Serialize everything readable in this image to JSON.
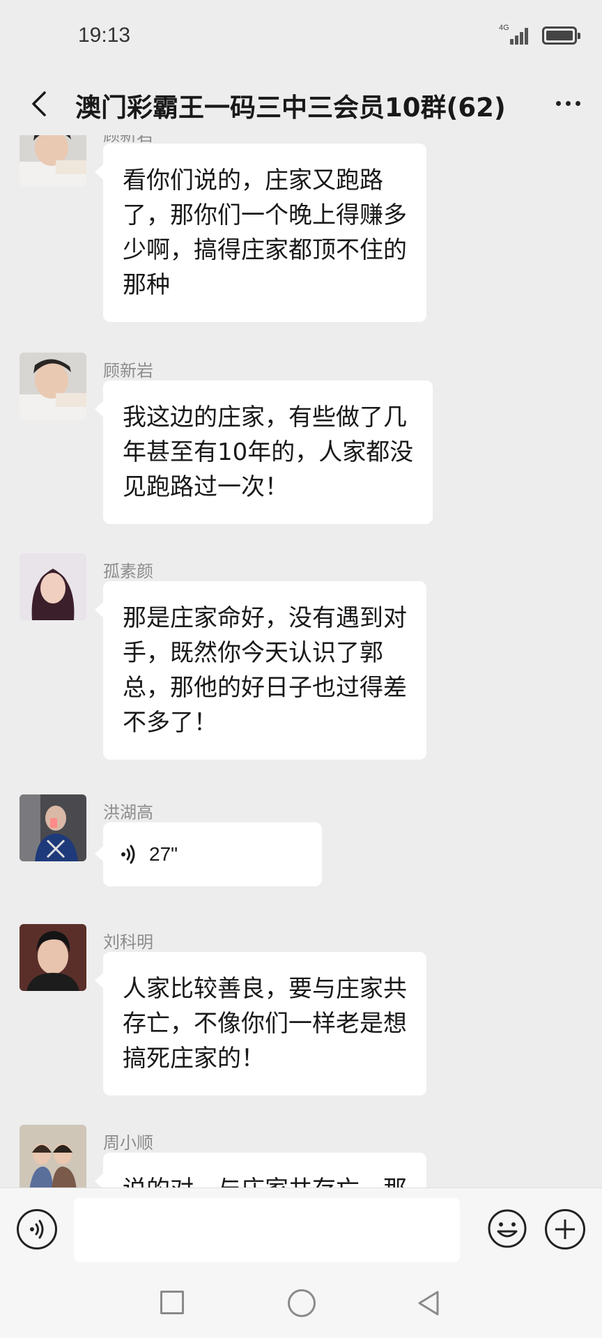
{
  "status_bar": {
    "time": "19:13",
    "network": "4G"
  },
  "header": {
    "title": "澳门彩霸王一码三中三会员10群(62)",
    "back_icon": "chevron-left-icon",
    "more_icon": "more-dots-icon"
  },
  "messages": [
    {
      "sender": "顾新岩",
      "type": "text",
      "lines": [
        "看你们说的，庄家又跑路",
        "了，那你们一个晚上得赚多",
        "少啊，搞得庄家都顶不住的",
        "那种"
      ]
    },
    {
      "sender": "顾新岩",
      "type": "text",
      "lines": [
        "我这边的庄家，有些做了几",
        "年甚至有10年的，人家都没",
        "见跑路过一次！"
      ]
    },
    {
      "sender": "孤素颜",
      "type": "text",
      "lines": [
        "那是庄家命好，没有遇到对",
        "手，既然你今天认识了郭",
        "总，那他的好日子也过得差",
        "不多了！"
      ]
    },
    {
      "sender": "洪湖高",
      "type": "voice",
      "duration": "27\""
    },
    {
      "sender": "刘科明",
      "type": "text",
      "lines": [
        "人家比较善良，要与庄家共",
        "存亡，不像你们一样老是想",
        "搞死庄家的！"
      ]
    },
    {
      "sender": "周小顺",
      "type": "text",
      "lines": [
        "说的对，与庄家共存亡，那"
      ]
    }
  ],
  "input_bar": {
    "voice_icon": "voice-mode-icon",
    "emoji_icon": "emoji-icon",
    "plus_icon": "plus-icon",
    "message_value": ""
  },
  "nav_bar": {
    "recents_icon": "square-recents-icon",
    "home_icon": "circle-home-icon",
    "back_icon": "triangle-back-icon"
  }
}
